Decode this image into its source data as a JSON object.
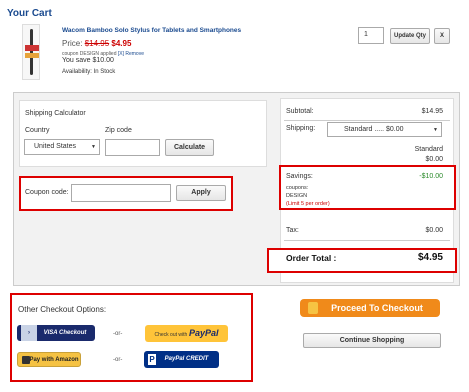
{
  "cart": {
    "title": "Your Cart"
  },
  "item": {
    "name": "Wacom Bamboo Solo Stylus for Tablets and Smartphones",
    "price_label": "Price:",
    "old_price": "$14.95",
    "new_price": "$4.95",
    "coupon_applied": "coupon DESIGN applied",
    "remove_link": "[X] Remove",
    "you_save": "You save $10.00",
    "availability": "Availability: In Stock",
    "qty": "1",
    "update_label": "Update Qty",
    "remove_label": "X"
  },
  "shipping": {
    "title": "Shipping Calculator",
    "country_label": "Country",
    "country_value": "United States",
    "zip_label": "Zip code",
    "zip_value": "",
    "calculate_label": "Calculate"
  },
  "coupon": {
    "label": "Coupon code:",
    "value": "",
    "apply_label": "Apply"
  },
  "summary": {
    "subtotal_label": "Subtotal:",
    "subtotal_value": "$14.95",
    "shipping_label": "Shipping:",
    "shipping_option": "Standard ..... $0.00",
    "shipping_name": "Standard",
    "shipping_value": "$0.00",
    "savings_label": "Savings:",
    "savings_value": "-$10.00",
    "coupons_label": "coupons:",
    "coupons_code": "DESIGN",
    "coupons_limit": "(Limit 5 per order)",
    "tax_label": "Tax:",
    "tax_value": "$0.00",
    "total_label": "Order Total :",
    "total_value": "$4.95"
  },
  "checkout": {
    "other_title": "Other Checkout Options:",
    "visa_label": "VISA Checkout",
    "paypal_prefix": "Check out with",
    "paypal_label": "PayPal",
    "amazon_label": "Pay with Amazon",
    "paypal_credit_label": "PayPal CREDIT",
    "or_label": "-or-",
    "proceed_label": "Proceed To Checkout",
    "continue_label": "Continue Shopping"
  }
}
